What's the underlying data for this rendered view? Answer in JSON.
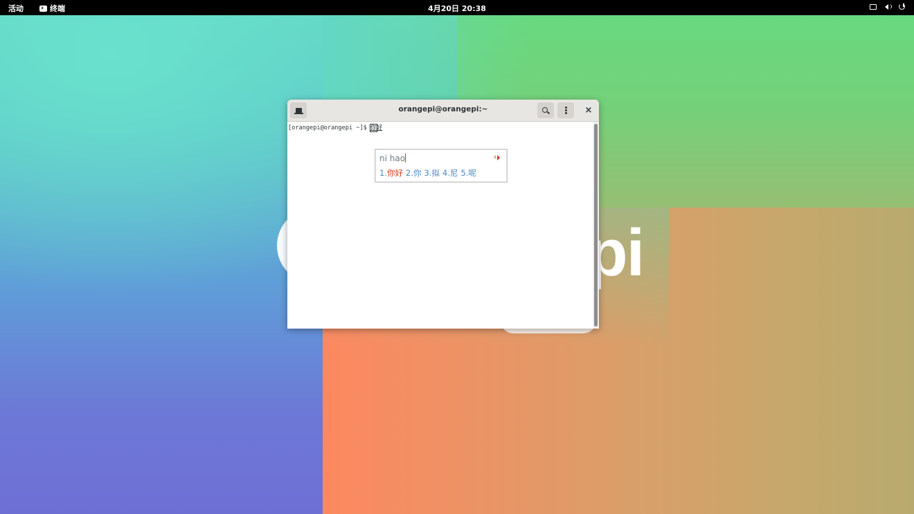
{
  "topbar": {
    "activities": "活动",
    "app_name": "终端",
    "clock": "4月20日 20:38",
    "tray_icons": [
      "screen-icon",
      "volume-icon",
      "power-icon"
    ]
  },
  "wallpaper": {
    "logo_text": "pi"
  },
  "terminal": {
    "title": "orangepi@orangepi:~",
    "prompt": "[orangepi@orangepi ~]$ ",
    "preedit_first": "你",
    "preedit_rest": "好",
    "close_glyph": "×"
  },
  "ime": {
    "preedit": "ni hao",
    "candidates": [
      {
        "index": "1.",
        "text": "你好"
      },
      {
        "index": "2.",
        "text": "你"
      },
      {
        "index": "3.",
        "text": "拟"
      },
      {
        "index": "4.",
        "text": "尼"
      },
      {
        "index": "5.",
        "text": "呢"
      }
    ],
    "colors": {
      "selected": "#d9361f",
      "candidate": "#4a86c5"
    }
  }
}
